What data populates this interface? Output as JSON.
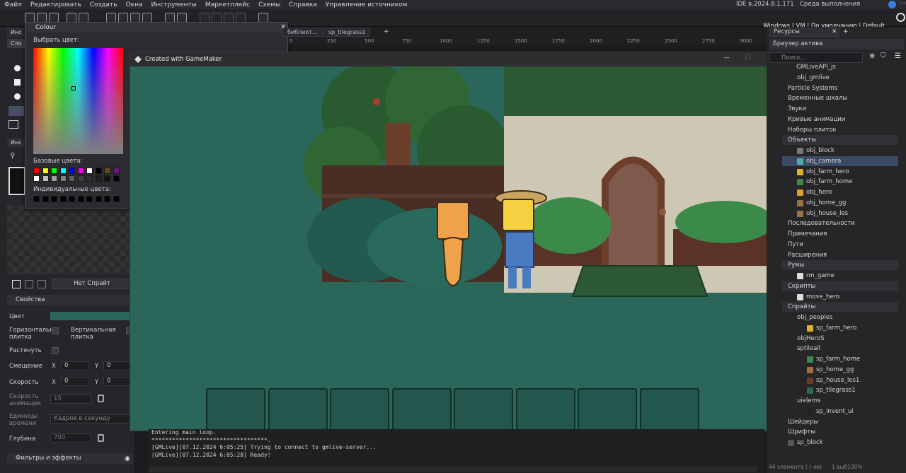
{
  "menu": [
    "Файл",
    "Редактировать",
    "Создать",
    "Окна",
    "Инструменты",
    "Маркетплейс",
    "Схемы",
    "Справка",
    "Управление источником"
  ],
  "ide_version": "IDE в.2024.8.1.171",
  "runtime_version": "Среда выполнения в.2024.8.1.218",
  "env": {
    "platform": "Windows",
    "vm": "VM",
    "config": "По умолчанию",
    "target": "Default"
  },
  "left": {
    "tab1": "Инс",
    "tab2": "Сло",
    "tab3": "Инс",
    "no_sprite": "Нет Спрайт",
    "props_header": "Свойства",
    "color_label": "Цвет",
    "horiz_tile": "Горизонтальн плитка",
    "vert_tile": "Вертикальная плитка",
    "stretch": "Растянуть",
    "offset": "Смещение",
    "speed": "Скорость",
    "anim_speed": "Скорость анимации",
    "units": "Единицы времени",
    "depth": "Глубина",
    "x": "X",
    "y": "Y",
    "offset_x": "0",
    "offset_y": "0",
    "speed_x": "0",
    "speed_y": "0",
    "anim_speed_value": "15",
    "units_value": "Кадров в секунду",
    "depth_value": "700",
    "filters": "Фильтры и эффекты"
  },
  "colour_dialog": {
    "title": "Colour",
    "choose": "Выбрать цвет:",
    "base_colors": "Базовые цвета:",
    "custom_colors": "Индивидуальные цвета:",
    "base_row1": [
      "#ff0000",
      "#ffff00",
      "#00ff00",
      "#00ffff",
      "#0000ff",
      "#ff00ff",
      "#ffffff",
      "#000000",
      "#6b4a1e",
      "#6a1a7a"
    ],
    "base_row2": [
      "#ffffff",
      "#c0c0c0",
      "#a0a0a0",
      "#808080",
      "#606060",
      "#404040",
      "#303030",
      "#202020",
      "#101010",
      "#000000"
    ]
  },
  "tabs": [
    "библиот…",
    "sp_tilegrass1"
  ],
  "ruler": [
    "0",
    "250",
    "500",
    "750",
    "1000",
    "1250",
    "1500",
    "1750",
    "2000",
    "2250",
    "2500",
    "2750",
    "3000"
  ],
  "game": {
    "title": "Created with GameMaker",
    "slots": 8
  },
  "console": [
    "Entering main loop.",
    "**********************************.",
    "[GMLive][07.12.2024 6:05:25] Trying to connect to gmlive-server...",
    "[GMLive][07.12.2024 6:05:28] Ready!"
  ],
  "right": {
    "tab": "Ресурсы",
    "browser": "Браузер актива",
    "search_placeholder": "Поиск...",
    "items": [
      "GMLiveAPI_js",
      "obj_gmlive",
      "Particle Systems",
      "Временные шкалы",
      "Звуки",
      "Кривые анимации",
      "Наборы плиток",
      "Объекты",
      "obj_block",
      "obj_camera",
      "obj_farm_hero",
      "obj_farm_home",
      "obj_hero",
      "obj_home_gg",
      "obj_house_les",
      "Последовательности",
      "Примечания",
      "Пути",
      "Расширения",
      "Румы",
      "rm_game",
      "Скрипты",
      "move_hero",
      "Спрайты",
      "obj_peoples",
      "sp_farm_hero",
      "objHeroS",
      "sptileall",
      "sp_farm_home",
      "sp_home_gg",
      "sp_house_les1",
      "sp_tilegrass1",
      "uielems",
      "sp_invent_ui",
      "Шейдеры",
      "Шрифты",
      "sp_block"
    ],
    "footer": "44 элемента (-(-ов)",
    "zoom": "1 выб100%"
  }
}
